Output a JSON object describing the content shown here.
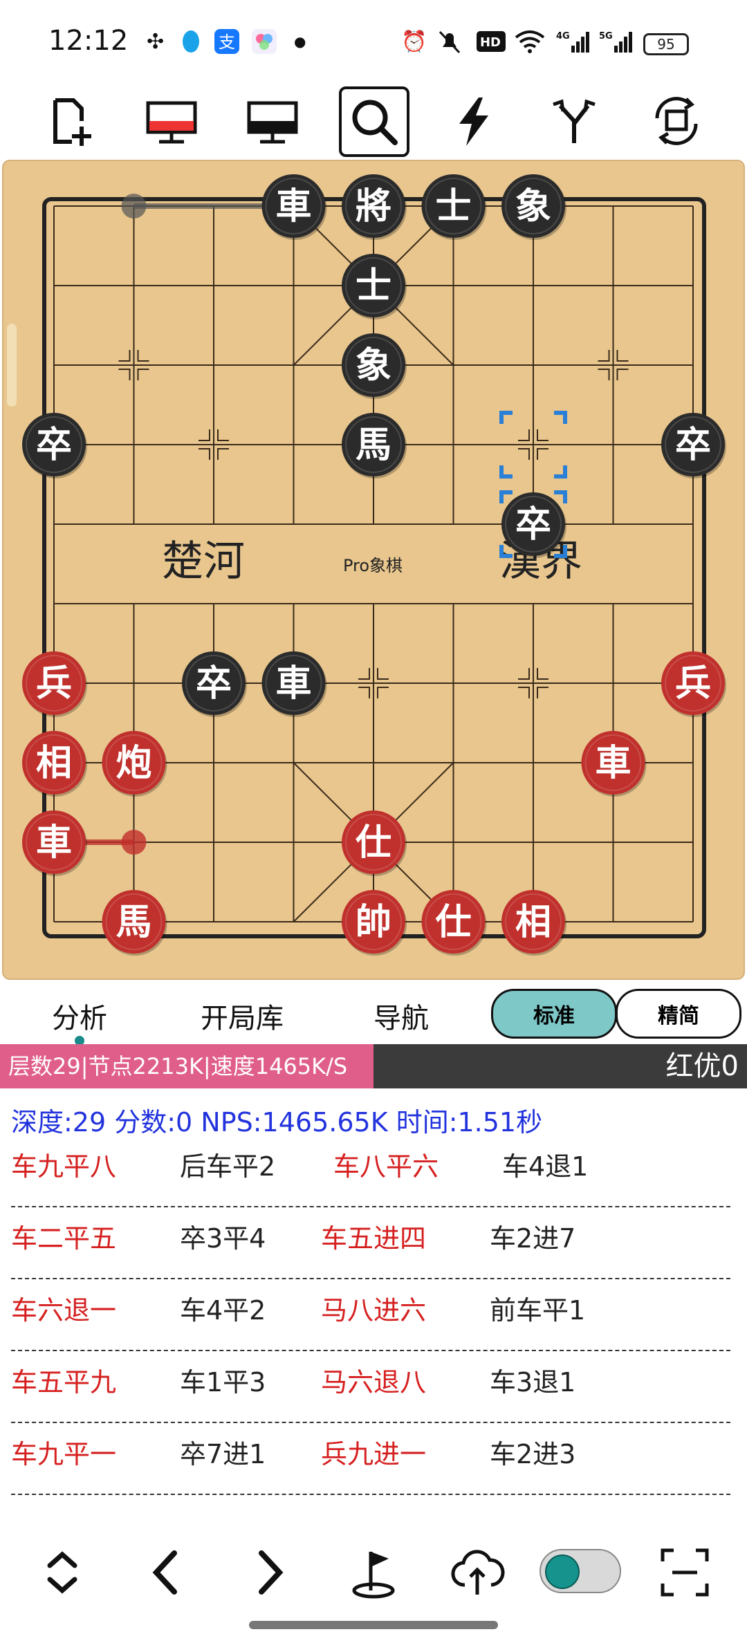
{
  "status_bar": {
    "time": "12:12",
    "battery": "95",
    "icons": [
      "pinwheel-icon",
      "qq-icon",
      "alipay-icon",
      "app-icon",
      "dot-icon",
      "alarm-icon",
      "mute-icon",
      "hd-icon",
      "wifi-icon",
      "4g-signal-icon",
      "5g-signal-icon"
    ]
  },
  "toolbar": {
    "buttons": [
      "new-game-icon",
      "red-monitor-icon",
      "black-monitor-icon",
      "search-icon",
      "lightning-icon",
      "branch-icon",
      "rotate-board-icon"
    ]
  },
  "board": {
    "river_left": "楚河",
    "river_center": "Pro象棋",
    "river_right": "漢界",
    "colors": {
      "board": "#e8c68e",
      "line": "#3a2a1a",
      "black_piece": "#2b2b2b",
      "red_piece": "#c0302c",
      "selection": "#2a7fd6"
    },
    "pieces": [
      {
        "side": "black",
        "label": "車",
        "file": 3,
        "rank": 0
      },
      {
        "side": "black",
        "label": "將",
        "file": 4,
        "rank": 0
      },
      {
        "side": "black",
        "label": "士",
        "file": 5,
        "rank": 0
      },
      {
        "side": "black",
        "label": "象",
        "file": 6,
        "rank": 0
      },
      {
        "side": "black",
        "label": "士",
        "file": 4,
        "rank": 1
      },
      {
        "side": "black",
        "label": "象",
        "file": 4,
        "rank": 2
      },
      {
        "side": "black",
        "label": "卒",
        "file": 0,
        "rank": 3
      },
      {
        "side": "black",
        "label": "馬",
        "file": 4,
        "rank": 3
      },
      {
        "side": "black",
        "label": "卒",
        "file": 8,
        "rank": 3
      },
      {
        "side": "black",
        "label": "卒",
        "file": 6,
        "rank": 4
      },
      {
        "side": "black",
        "label": "卒",
        "file": 2,
        "rank": 6
      },
      {
        "side": "black",
        "label": "車",
        "file": 3,
        "rank": 6
      },
      {
        "side": "red",
        "label": "兵",
        "file": 0,
        "rank": 6
      },
      {
        "side": "red",
        "label": "兵",
        "file": 8,
        "rank": 6
      },
      {
        "side": "red",
        "label": "相",
        "file": 0,
        "rank": 7
      },
      {
        "side": "red",
        "label": "炮",
        "file": 1,
        "rank": 7
      },
      {
        "side": "red",
        "label": "車",
        "file": 7,
        "rank": 7
      },
      {
        "side": "red",
        "label": "車",
        "file": 0,
        "rank": 8
      },
      {
        "side": "red",
        "label": "仕",
        "file": 4,
        "rank": 8
      },
      {
        "side": "red",
        "label": "馬",
        "file": 1,
        "rank": 9
      },
      {
        "side": "red",
        "label": "帥",
        "file": 4,
        "rank": 9
      },
      {
        "side": "red",
        "label": "仕",
        "file": 5,
        "rank": 9
      },
      {
        "side": "red",
        "label": "相",
        "file": 6,
        "rank": 9
      }
    ]
  },
  "tabs": {
    "analysis": "分析",
    "opening_book": "开局库",
    "navigation": "导航",
    "standard": "标准",
    "simple": "精简"
  },
  "engine": {
    "stats": "层数29|节点2213K|速度1465K/S",
    "eval": "红优0",
    "depth_line": "深度:29 分数:0 NPS:1465.65K 时间:1.51秒"
  },
  "moves": [
    [
      "车九平八",
      "后车平2",
      "车八平六",
      "车4退1"
    ],
    [
      "车二平五",
      "卒3平4",
      "车五进四",
      "车2进7"
    ],
    [
      "车六退一",
      "车4平2",
      "马八进六",
      "前车平1"
    ],
    [
      "车五平九",
      "车1平3",
      "马六退八",
      "车3退1"
    ],
    [
      "车九平一",
      "卒7进1",
      "兵九进一",
      "车2进3"
    ]
  ],
  "bottom_bar": {
    "buttons": [
      "up-down-icon",
      "back-icon",
      "forward-icon",
      "flag-icon",
      "cloud-upload-icon",
      "toggle",
      "scan-icon"
    ]
  }
}
